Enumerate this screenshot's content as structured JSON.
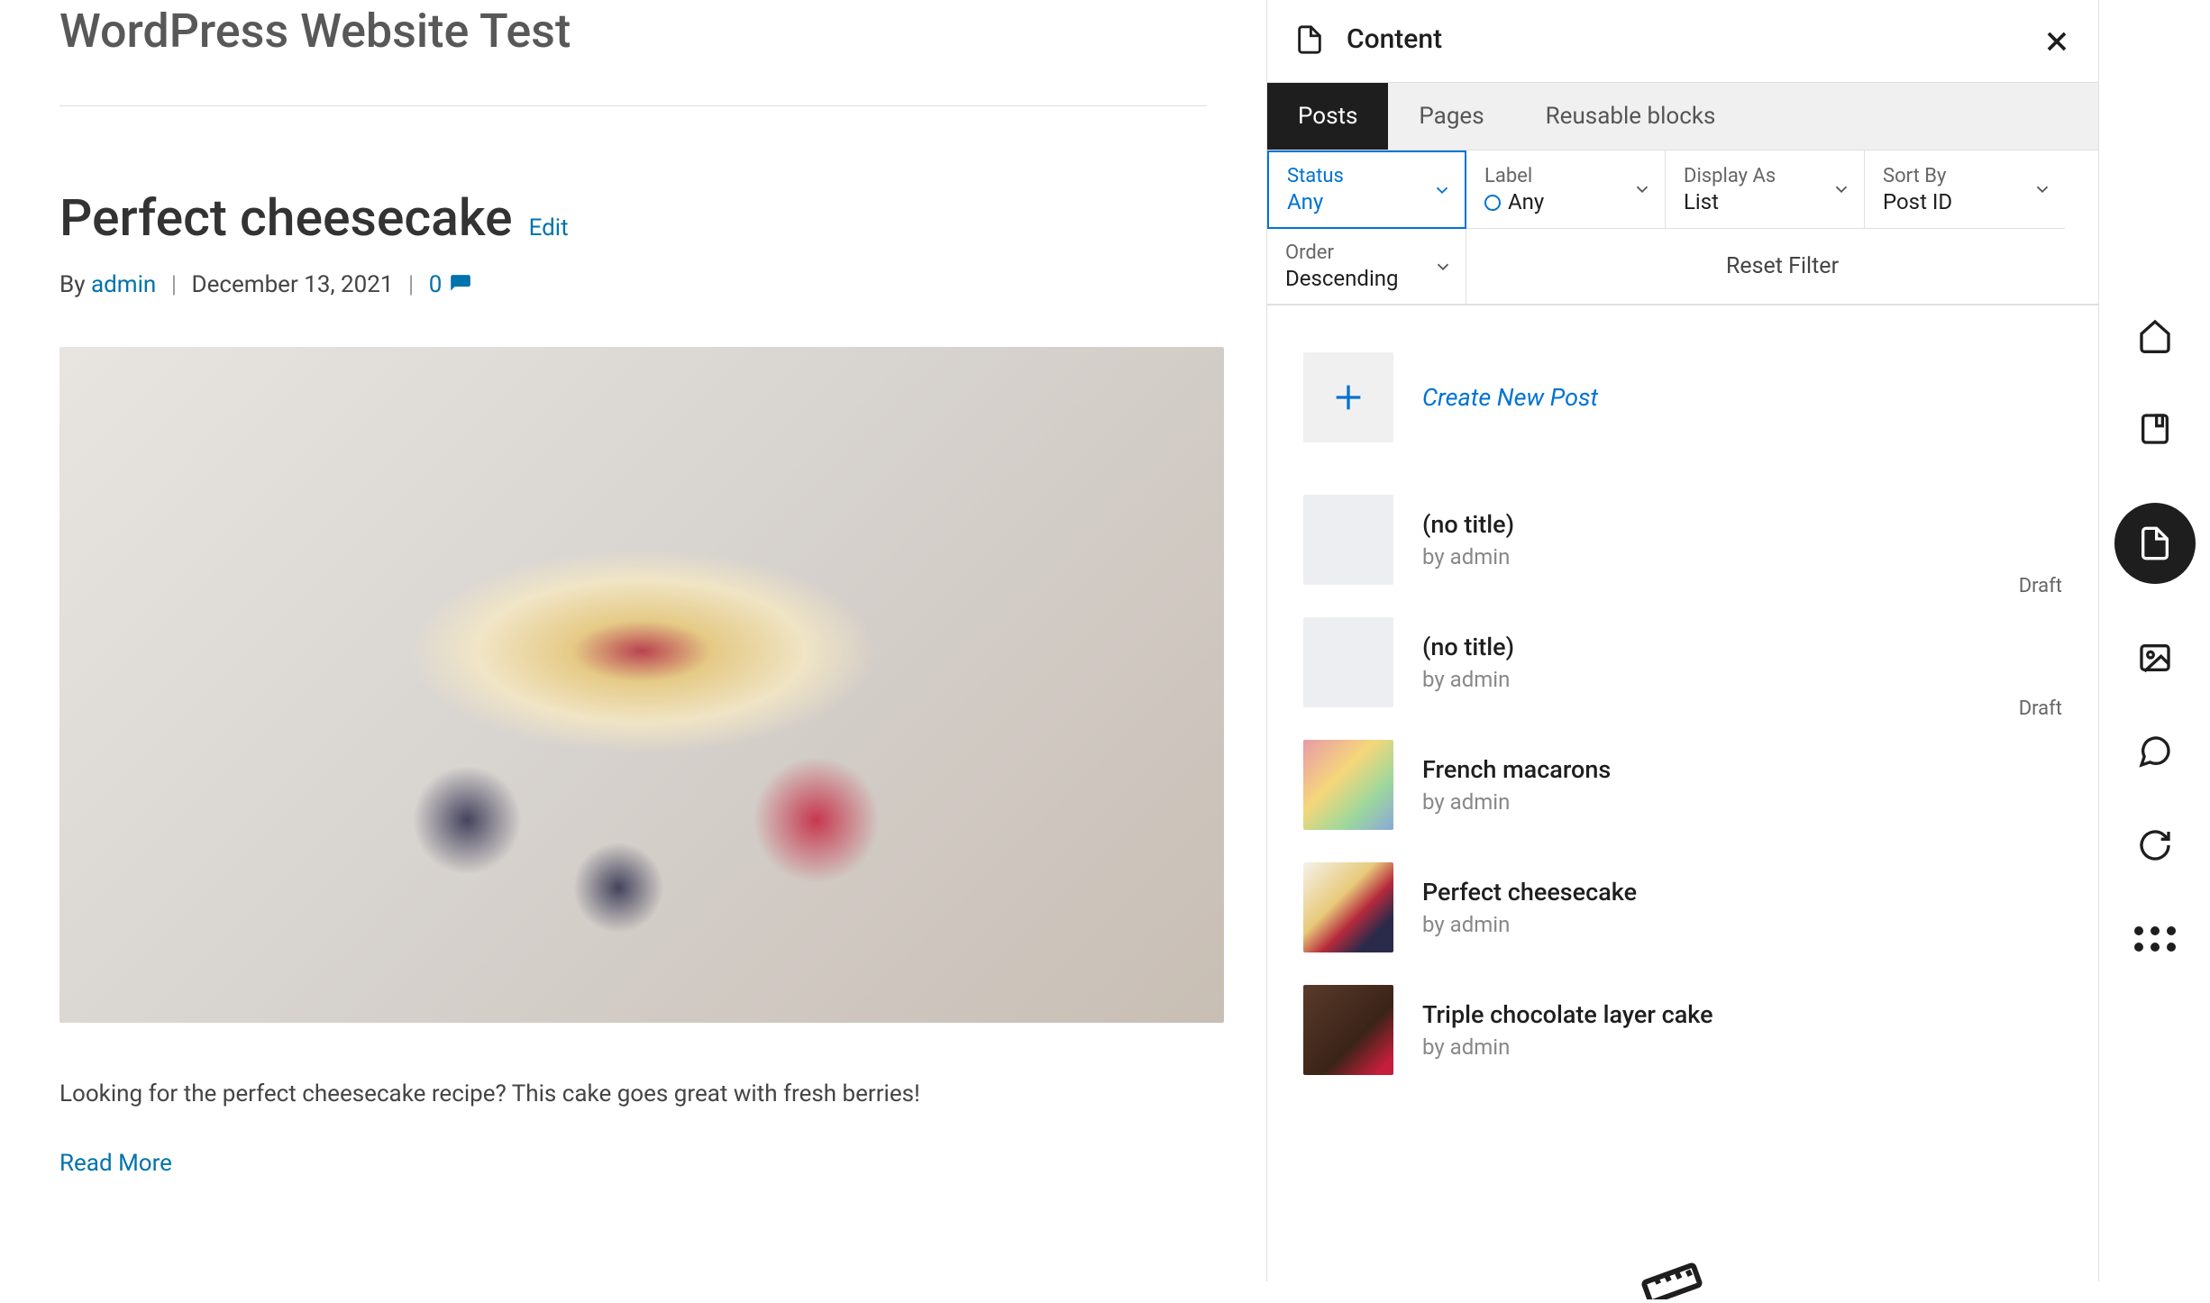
{
  "site": {
    "title": "WordPress Website Test"
  },
  "post": {
    "title": "Perfect cheesecake",
    "edit_label": "Edit",
    "by_label": "By",
    "author": "admin",
    "date": "December 13, 2021",
    "comment_count": "0",
    "excerpt": "Looking for the perfect cheesecake recipe? This cake goes great with fresh berries!",
    "read_more_label": "Read More"
  },
  "panel": {
    "title": "Content",
    "tabs": [
      {
        "label": "Posts",
        "active": true
      },
      {
        "label": "Pages",
        "active": false
      },
      {
        "label": "Reusable blocks",
        "active": false
      }
    ],
    "filters": {
      "status": {
        "label": "Status",
        "value": "Any"
      },
      "label": {
        "label": "Label",
        "value": "Any"
      },
      "display_as": {
        "label": "Display As",
        "value": "List"
      },
      "sort_by": {
        "label": "Sort By",
        "value": "Post ID"
      },
      "order": {
        "label": "Order",
        "value": "Descending"
      },
      "reset_label": "Reset Filter"
    },
    "create_new_label": "Create New Post",
    "posts": [
      {
        "title": "(no title)",
        "author": "by admin",
        "badge": "Draft",
        "thumb": ""
      },
      {
        "title": "(no title)",
        "author": "by admin",
        "badge": "Draft",
        "thumb": ""
      },
      {
        "title": "French macarons",
        "author": "by admin",
        "badge": "",
        "thumb": "img-macarons"
      },
      {
        "title": "Perfect cheesecake",
        "author": "by admin",
        "badge": "",
        "thumb": "img-cheesecake"
      },
      {
        "title": "Triple chocolate layer cake",
        "author": "by admin",
        "badge": "",
        "thumb": "img-chocolate"
      }
    ]
  }
}
